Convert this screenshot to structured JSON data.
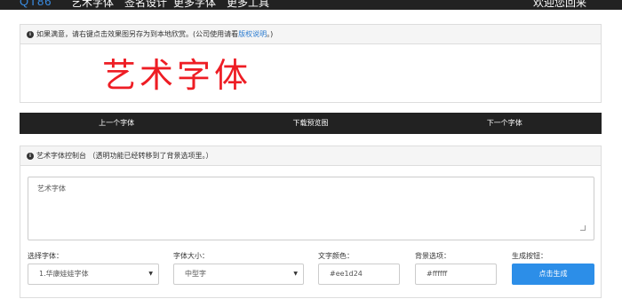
{
  "topbar": {
    "logo": "QT86",
    "nav_items": [
      "艺术字体",
      "签名设计",
      "更多字体",
      "更多工具"
    ],
    "right_link": "欢迎您回来"
  },
  "preview": {
    "tip_icon": "info-icon",
    "tip_text": "如果满意，请右键点击效果图另存为到本地欣赏。(公司使用请看",
    "tip_link": "版权说明",
    "tip_end": "。)",
    "art_text": "艺术字体",
    "art_color": "#ee1d24"
  },
  "actions": {
    "prev": "上一个字体",
    "download": "下载预览图",
    "next": "下一个字体"
  },
  "control": {
    "title": "艺术字体控制台 （透明功能已经转移到了背景选项里。）",
    "content_value": "艺术字体",
    "font_label": "选择字体：",
    "font_value": "1.华康娃娃字体",
    "size_label": "字体大小：",
    "size_value": "中型字",
    "color_label": "文字颜色：",
    "color_value": "#ee1d24",
    "bg_label": "背景选项：",
    "bg_value": "#ffffff",
    "gen_label": "生成按钮：",
    "gen_button": "点击生成"
  },
  "colors": {
    "accent": "#2c8ee8",
    "dark_bar": "#222222"
  }
}
